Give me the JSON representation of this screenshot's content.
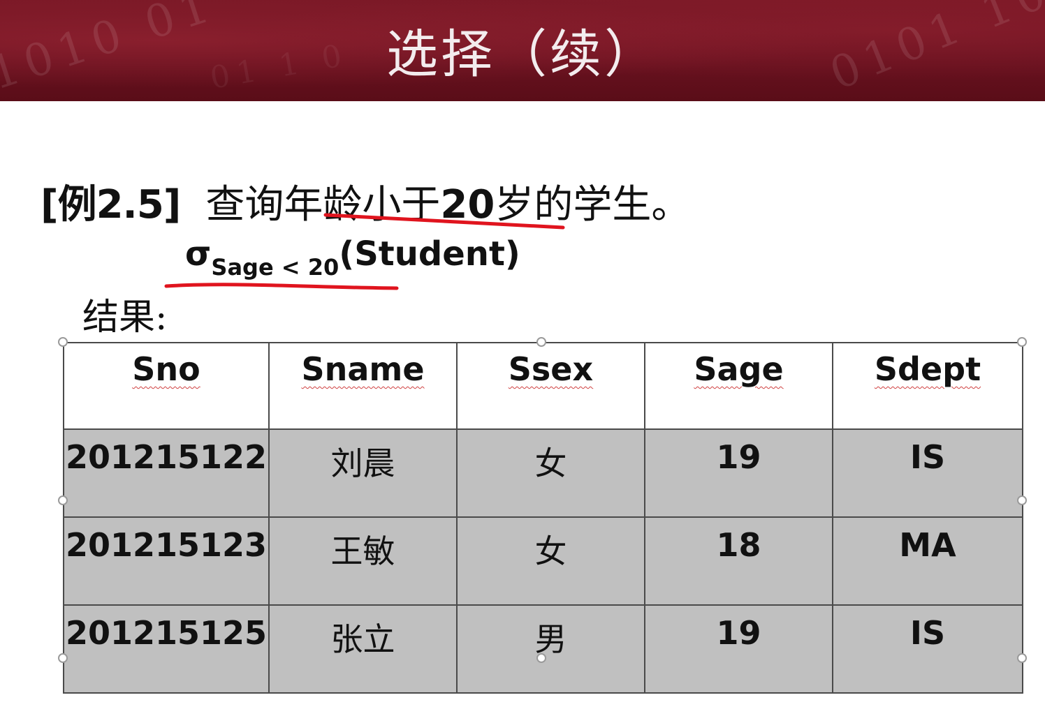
{
  "slide": {
    "title": "选择（续）",
    "example": {
      "tag": "[例2.5]",
      "query_pre": "查询年龄小于",
      "query_num": "20",
      "query_post": "岁的学生。"
    },
    "expression": {
      "sigma": "σ",
      "condition": "Sage < 20",
      "argument": "(Student)"
    },
    "result_label": "结果:"
  },
  "table": {
    "headers": [
      "Sno",
      "Sname",
      "Ssex",
      "Sage",
      "Sdept"
    ],
    "rows": [
      [
        "201215122",
        "刘晨",
        "女",
        "19",
        "IS"
      ],
      [
        "201215123",
        "王敏",
        "女",
        "18",
        "MA"
      ],
      [
        "201215125",
        "张立",
        "男",
        "19",
        "IS"
      ]
    ]
  },
  "colors": {
    "banner": "#6a1220",
    "annotation_red": "#e0141e",
    "row_fill": "#c0c0c0"
  }
}
